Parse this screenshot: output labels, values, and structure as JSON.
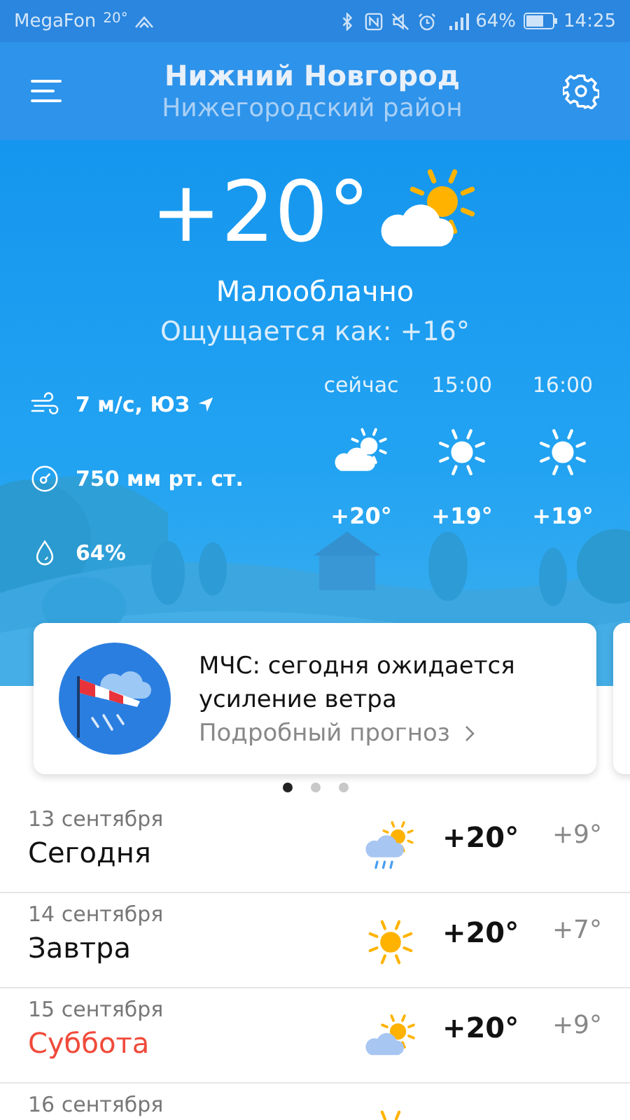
{
  "status_bar": {
    "carrier": "MegaFon",
    "temperature": "20°",
    "battery": "64%",
    "time": "14:25"
  },
  "header": {
    "city": "Нижний Новгород",
    "district": "Нижегородский район"
  },
  "current": {
    "temperature": "+20°",
    "kind": "partly-cloudy",
    "condition": "Малооблачно",
    "feels_like": "Ощущается как: +16°"
  },
  "details": [
    {
      "kind": "wind",
      "text": "7 м/с, ЮЗ"
    },
    {
      "kind": "pressure",
      "text": "750 мм рт. ст."
    },
    {
      "kind": "humidity",
      "text": "64%"
    }
  ],
  "hourly": [
    {
      "time": "сейчас",
      "kind": "partly-cloudy",
      "temperature": "+20°"
    },
    {
      "time": "15:00",
      "kind": "sun",
      "temperature": "+19°"
    },
    {
      "time": "16:00",
      "kind": "sun",
      "temperature": "+19°"
    }
  ],
  "alert": {
    "title": "МЧС: сегодня ожидается усиление ветра",
    "link": "Подробный прогноз"
  },
  "pager": [
    {
      "selected": true
    },
    {
      "selected": false
    },
    {
      "selected": false
    }
  ],
  "days": [
    {
      "date": "13 сентября",
      "name": "Сегодня",
      "weekend": false,
      "kind": "rain",
      "day": "+20°",
      "night": "+9°"
    },
    {
      "date": "14 сентября",
      "name": "Завтра",
      "weekend": false,
      "kind": "sun",
      "day": "+20°",
      "night": "+7°"
    },
    {
      "date": "15 сентября",
      "name": "Суббота",
      "weekend": true,
      "kind": "partly-cloudy",
      "day": "+20°",
      "night": "+9°"
    },
    {
      "date": "16 сентября",
      "kind": "sun"
    }
  ]
}
